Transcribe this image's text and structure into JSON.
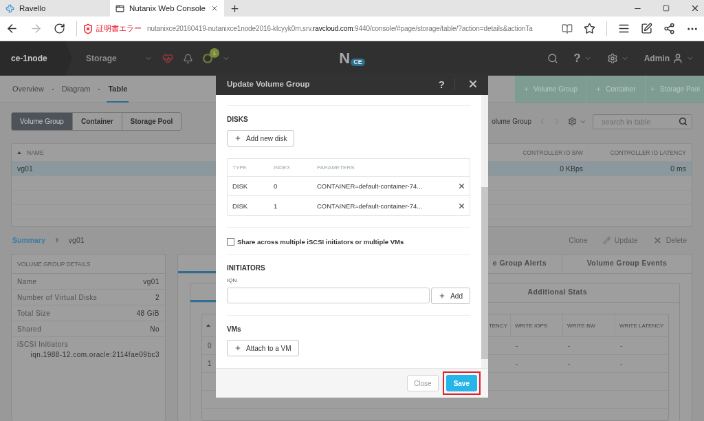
{
  "browser": {
    "tabs": [
      {
        "title": "Ravello",
        "selected": false
      },
      {
        "title": "Nutanix Web Console",
        "selected": true
      }
    ],
    "forward_disabled": true,
    "security": "証明書エラー",
    "url": {
      "before": "nutanixce20160419-nutanixce1node2016-klcyyk0m.srv.",
      "domain": "ravcloud.com",
      "after": ":9440/console/#page/storage/table/?action=details&actionTa"
    }
  },
  "app_bar": {
    "cluster": "ce-1node",
    "section": "Storage",
    "alerts_badge": "1",
    "logo": "N",
    "logo_badge": "CE",
    "help": "?",
    "user": "Admin"
  },
  "subnav": {
    "views": [
      {
        "label": "Overview",
        "selected": false
      },
      {
        "label": "Diagram",
        "selected": false
      },
      {
        "label": "Table",
        "selected": true
      }
    ],
    "actions": [
      "Volume Group",
      "Container",
      "Storage Pool"
    ]
  },
  "entity_tabs": [
    {
      "label": "Volume Group",
      "selected": true
    },
    {
      "label": "Container",
      "selected": false
    },
    {
      "label": "Storage Pool",
      "selected": false
    }
  ],
  "table_toolbar": {
    "entity_label": "olume Group",
    "search": {
      "placeholder": "search in table"
    }
  },
  "entity_table": {
    "columns": [
      "NAME",
      "CONTROLLER IO B/W",
      "CONTROLLER IO LATENCY"
    ],
    "rows": [
      {
        "name": "vg01",
        "io_bw": "0 KBps",
        "io_latency": "0 ms",
        "selected": true
      }
    ]
  },
  "breadcrumb": {
    "root": "Summary",
    "current": "vg01"
  },
  "entity_actions": [
    {
      "kind": "plain",
      "label": "Clone"
    },
    {
      "kind": "edit",
      "label": "Update"
    },
    {
      "kind": "delete",
      "label": "Delete"
    }
  ],
  "details": {
    "title": "VOLUME GROUP DETAILS",
    "rows": [
      {
        "kind": "inline",
        "label": "Name",
        "value": "vg01"
      },
      {
        "kind": "inline",
        "label": "Number of Virtual Disks",
        "value": "2"
      },
      {
        "kind": "inline",
        "label": "Total Size",
        "value": "48 GiB"
      },
      {
        "kind": "inline",
        "label": "Shared",
        "value": "No"
      },
      {
        "kind": "stacked",
        "label": "iSCSI Initiators",
        "value": "iqn.1988-12.com.oracle:2114fae09bc3"
      }
    ]
  },
  "detail_tabs": [
    {
      "selected": true
    },
    {
      "label": "e Group Alerts",
      "selected": false
    },
    {
      "label": "Volume Group Events",
      "selected": false
    }
  ],
  "stats_tabs": [
    {
      "selected": true
    },
    {
      "label": "Additional Stats",
      "selected": false
    }
  ],
  "stats_table": {
    "columns": [
      "TENCY",
      "WRITE IOPS",
      "WRITE BW",
      "WRITE LATENCY"
    ],
    "rows": [
      {
        "index": "0",
        "cells": [
          "",
          "-",
          "-",
          "-"
        ]
      },
      {
        "index": "1",
        "cells": [
          "",
          "-",
          "-",
          "-"
        ]
      }
    ]
  },
  "modal": {
    "title": "Update Volume Group",
    "help": "?",
    "disks": {
      "heading": "DISKS",
      "add": "Add new disk",
      "columns": [
        "TYPE",
        "INDEX",
        "PARAMETERS"
      ],
      "rows": [
        {
          "type": "DISK",
          "index": "0",
          "parameters": "CONTAINER=default-container-74..."
        },
        {
          "type": "DISK",
          "index": "1",
          "parameters": "CONTAINER=default-container-74..."
        }
      ]
    },
    "share": {
      "label": "Share across multiple iSCSI initiators or multiple VMs",
      "checked": false
    },
    "initiators": {
      "heading": "INITIATORS",
      "field_label": "IQN",
      "add": "Add"
    },
    "vms": {
      "heading": "VMs",
      "attach": "Attach to a VM"
    },
    "close": "Close",
    "save": "Save"
  }
}
